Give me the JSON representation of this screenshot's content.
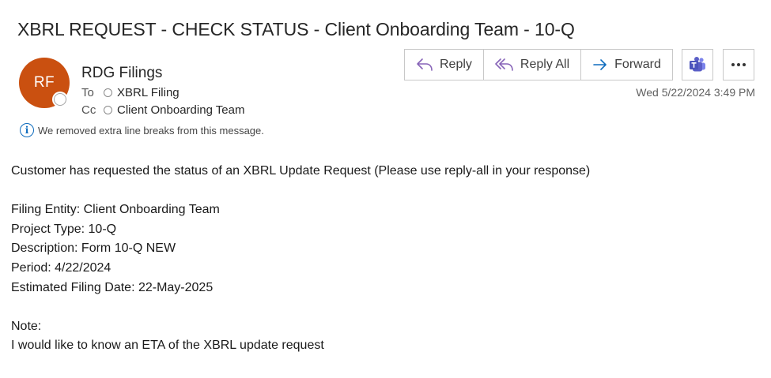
{
  "email": {
    "subject": "XBRL REQUEST - CHECK STATUS - Client Onboarding Team - 10-Q",
    "sender": {
      "initials": "RF",
      "name": "RDG Filings",
      "avatar_color": "#ca5010"
    },
    "to": {
      "label": "To",
      "name": "XBRL Filing"
    },
    "cc": {
      "label": "Cc",
      "name": "Client Onboarding Team"
    },
    "info_notice": "We removed extra line breaks from this message.",
    "timestamp": "Wed 5/22/2024 3:49 PM",
    "actions": {
      "reply": "Reply",
      "reply_all": "Reply All",
      "forward": "Forward",
      "teams_icon": "teams-icon",
      "more_icon": "more-icon"
    },
    "body": {
      "intro": "Customer has requested the status of an XBRL Update Request (Please use reply-all in your response)",
      "details": [
        "Filing Entity: Client Onboarding Team",
        "Project Type: 10-Q",
        "Description: Form 10-Q NEW",
        "Period: 4/22/2024",
        "Estimated Filing Date: 22-May-2025"
      ],
      "note_label": "Note:",
      "note_text": "I would like to know an ETA of the XBRL update request"
    }
  },
  "colors": {
    "accent": "#0f6cbd",
    "reply_icon": "#8764b8",
    "teams": "#5b5fc7"
  }
}
